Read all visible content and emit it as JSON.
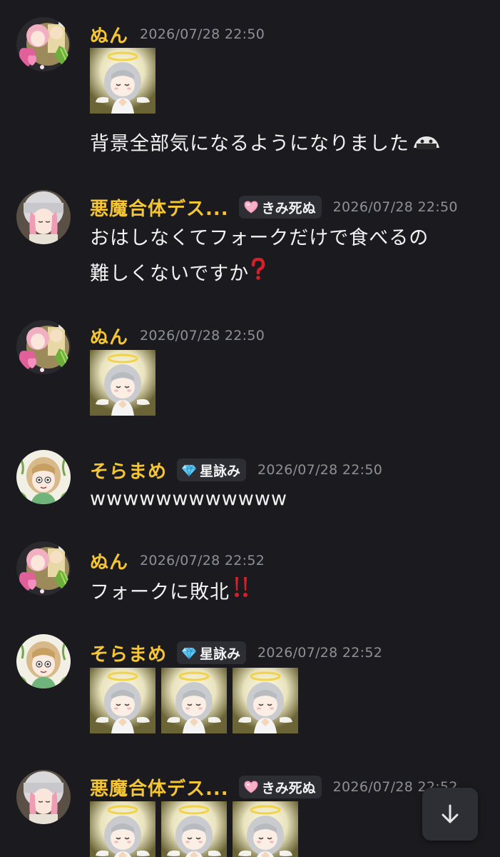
{
  "messages": [
    {
      "user": "ぬん",
      "timestamp": "2026/07/28 22:50",
      "text": "背景全部気になるようになりました"
    },
    {
      "user": "悪魔合体デス...",
      "role": "きみ死ぬ",
      "timestamp": "2026/07/28 22:50",
      "text_line1": "おはしなくてフォークだけで食べるの",
      "text_line2": "難しくないですか"
    },
    {
      "user": "ぬん",
      "timestamp": "2026/07/28 22:50"
    },
    {
      "user": "そらまめ",
      "role": "星詠み",
      "timestamp": "2026/07/28 22:50",
      "text": "wwwwwwwwwwww"
    },
    {
      "user": "ぬん",
      "timestamp": "2026/07/28 22:52",
      "text": "フォークに敗北"
    },
    {
      "user": "そらまめ",
      "role": "星詠み",
      "timestamp": "2026/07/28 22:52"
    },
    {
      "user": "悪魔合体デス...",
      "role": "きみ死ぬ",
      "timestamp": "2026/07/28 22:52"
    }
  ],
  "icons": {
    "role_heart": "pink-heart-icon",
    "role_gem": "diamond-icon",
    "question": "red-question-icon",
    "exclamation": "double-exclamation-icon",
    "scroll": "arrow-down-icon"
  },
  "colors": {
    "background": "#1b1b1f",
    "username": "#f4c534",
    "timestamp": "#8e9097",
    "text": "#f2f2f2",
    "badge_bg": "#2d2e34"
  }
}
